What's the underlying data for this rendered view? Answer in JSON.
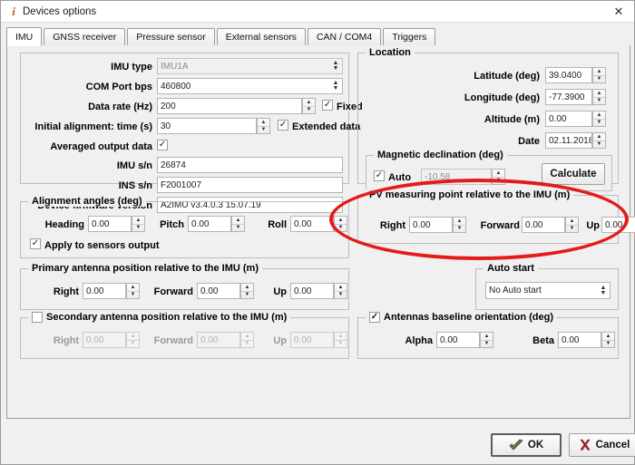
{
  "window": {
    "title": "Devices options",
    "info_icon": "info-icon",
    "close_label": "✕"
  },
  "tabs": [
    {
      "label": "IMU",
      "active": true
    },
    {
      "label": "GNSS receiver",
      "active": false
    },
    {
      "label": "Pressure sensor",
      "active": false
    },
    {
      "label": "External sensors",
      "active": false
    },
    {
      "label": "CAN / COM4",
      "active": false
    },
    {
      "label": "Triggers",
      "active": false
    }
  ],
  "imu_panel": {
    "imu_type": {
      "label": "IMU type",
      "value": "IMU1A",
      "readonly": true
    },
    "com_port_bps": {
      "label": "COM Port bps",
      "value": "460800"
    },
    "data_rate": {
      "label": "Data rate (Hz)",
      "value": "200"
    },
    "fixed": {
      "label": "Fixed",
      "checked": true,
      "mark": "✓"
    },
    "initial_alignment": {
      "label": "Initial alignment: time (s)",
      "value": "30"
    },
    "extended_data": {
      "label": "Extended data",
      "checked": true,
      "mark": "✓"
    },
    "averaged_output": {
      "label": "Averaged output data",
      "checked": true,
      "mark": "✓"
    },
    "imu_sn": {
      "label": "IMU s/n",
      "value": "26874"
    },
    "ins_sn": {
      "label": "INS s/n",
      "value": "F2001007"
    },
    "firmware": {
      "label": "Device firmware version",
      "value": "A2IMU v3.4.0.3 15.07.19"
    }
  },
  "alignment_angles": {
    "legend": "Alignment angles (deg)",
    "heading": {
      "label": "Heading",
      "value": "0.00"
    },
    "pitch": {
      "label": "Pitch",
      "value": "0.00"
    },
    "roll": {
      "label": "Roll",
      "value": "0.00"
    },
    "apply": {
      "label": "Apply to sensors output",
      "checked": true,
      "mark": "✓"
    }
  },
  "primary_antenna": {
    "legend": "Primary antenna position relative to the IMU (m)",
    "right": {
      "label": "Right",
      "value": "0.00"
    },
    "forward": {
      "label": "Forward",
      "value": "0.00"
    },
    "up": {
      "label": "Up",
      "value": "0.00"
    }
  },
  "secondary_antenna": {
    "legend": "Secondary antenna position relative to the IMU (m)",
    "enabled": false,
    "mark": "",
    "right": {
      "label": "Right",
      "value": "0.00"
    },
    "forward": {
      "label": "Forward",
      "value": "0.00"
    },
    "up": {
      "label": "Up",
      "value": "0.00"
    }
  },
  "location": {
    "legend": "Location",
    "latitude": {
      "label": "Latitude (deg)",
      "value": "39.0400"
    },
    "longitude": {
      "label": "Longitude (deg)",
      "value": "-77.3900"
    },
    "altitude": {
      "label": "Altitude (m)",
      "value": "0.00"
    },
    "date": {
      "label": "Date",
      "value": "02.11.2018"
    }
  },
  "magnetic_declination": {
    "legend": "Magnetic declination (deg)",
    "auto": {
      "label": "Auto",
      "checked": true,
      "mark": "✓"
    },
    "value": "-10.58",
    "calculate_button": "Calculate"
  },
  "pv_point": {
    "legend": "PV measuring point relative to the IMU (m)",
    "right": {
      "label": "Right",
      "value": "0.00"
    },
    "forward": {
      "label": "Forward",
      "value": "0.00"
    },
    "up": {
      "label": "Up",
      "value": "0.00"
    },
    "highlight_color": "#e31b19"
  },
  "auto_start": {
    "legend": "Auto start",
    "selected": "No Auto start"
  },
  "antennas_baseline": {
    "legend": "Antennas baseline orientation (deg)",
    "enabled": true,
    "mark": "✓",
    "alpha": {
      "label": "Alpha",
      "value": "0.00"
    },
    "beta": {
      "label": "Beta",
      "value": "0.00"
    }
  },
  "footer": {
    "ok": {
      "label": "OK",
      "icon": "check-arrow-icon"
    },
    "cancel": {
      "label": "Cancel",
      "icon": "x-mark-icon"
    }
  }
}
